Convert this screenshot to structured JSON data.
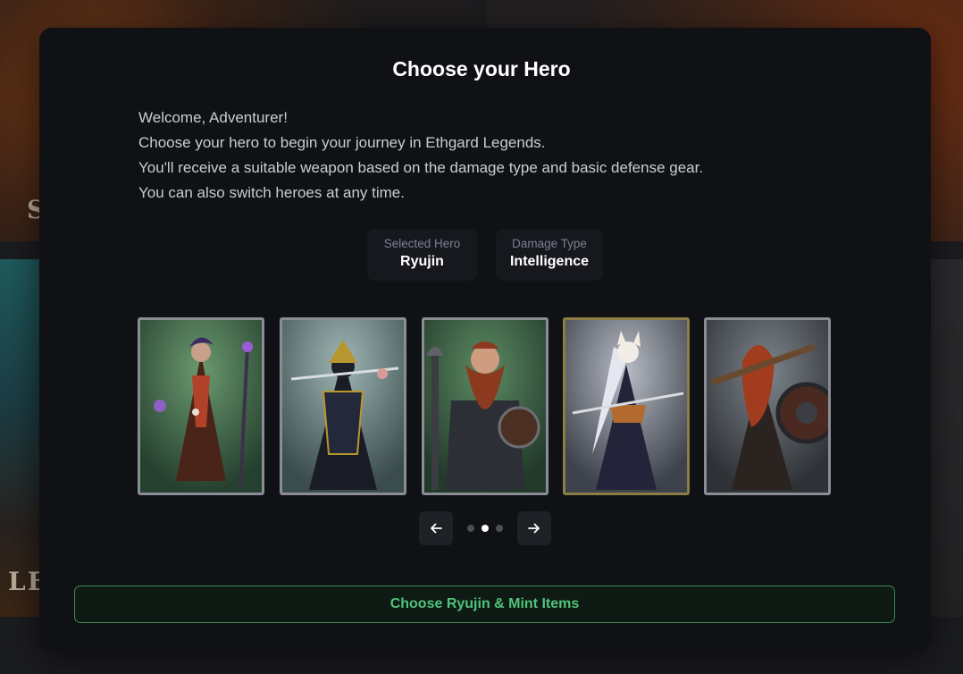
{
  "background": {
    "letters_top_left": "S",
    "letters_bottom_left": "LE"
  },
  "modal": {
    "title": "Choose your Hero",
    "intro_lines": [
      "Welcome, Adventurer!",
      "Choose your hero to begin your journey in Ethgard Legends.",
      "You'll receive a suitable weapon based on the damage type and basic defense gear.",
      "You can also switch heroes at any time."
    ],
    "selected_hero": {
      "label": "Selected Hero",
      "value": "Ryujin"
    },
    "damage_type": {
      "label": "Damage Type",
      "value": "Intelligence"
    },
    "heroes": [
      {
        "icon": "sorcerer-portrait",
        "selected": false
      },
      {
        "icon": "samurai-portrait",
        "selected": false
      },
      {
        "icon": "dwarf-warrior-portrait",
        "selected": false
      },
      {
        "icon": "fox-masked-swordswoman-portrait",
        "selected": true
      },
      {
        "icon": "shield-maiden-portrait",
        "selected": false
      }
    ],
    "pager": {
      "pages": 3,
      "current": 2,
      "prev_icon": "arrow-left-icon",
      "next_icon": "arrow-right-icon"
    },
    "cta_label": "Choose Ryujin & Mint Items",
    "colors": {
      "accent_green": "#4ec47a",
      "selected_frame": "#8b7e45",
      "frame": "#8a8d94"
    }
  }
}
